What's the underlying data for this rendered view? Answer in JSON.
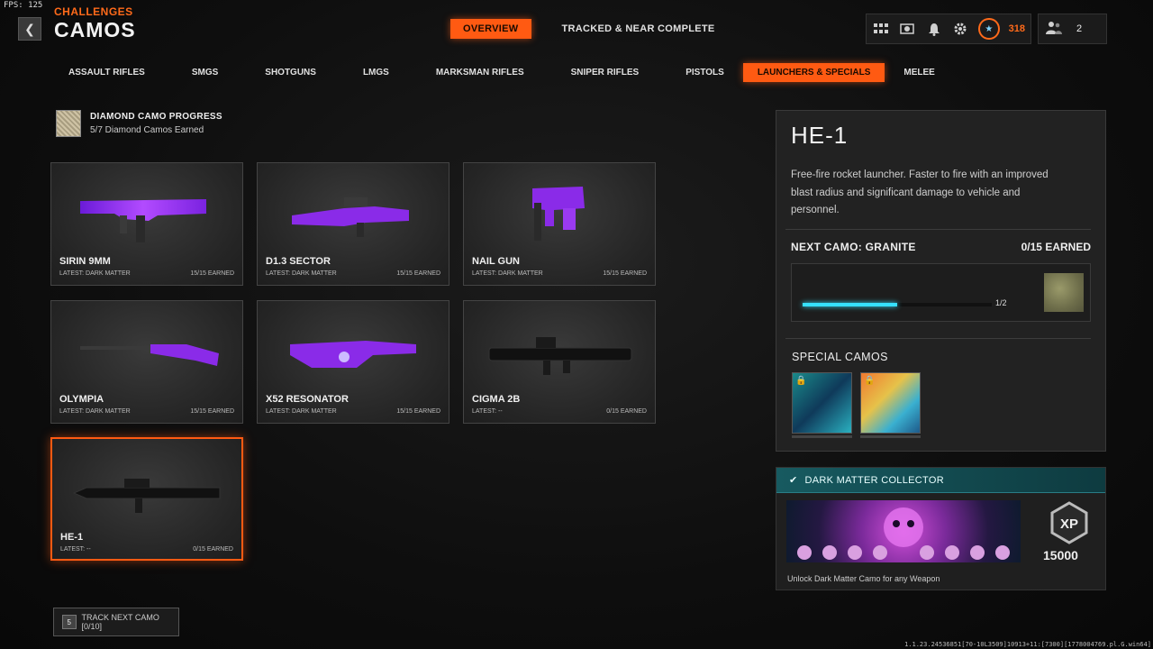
{
  "fps": "FPS: 125",
  "header": {
    "breadcrumb": "CHALLENGES",
    "title": "CAMOS",
    "tabs": [
      {
        "label": "OVERVIEW",
        "active": true
      },
      {
        "label": "TRACKED & NEAR COMPLETE",
        "active": false
      }
    ],
    "rank_value": "318",
    "party_count": "2"
  },
  "categories": [
    {
      "label": "ASSAULT RIFLES"
    },
    {
      "label": "SMGS"
    },
    {
      "label": "SHOTGUNS"
    },
    {
      "label": "LMGS"
    },
    {
      "label": "MARKSMAN RIFLES"
    },
    {
      "label": "SNIPER RIFLES"
    },
    {
      "label": "PISTOLS"
    },
    {
      "label": "LAUNCHERS & SPECIALS",
      "active": true
    },
    {
      "label": "MELEE"
    }
  ],
  "diamond": {
    "title": "DIAMOND CAMO PROGRESS",
    "subtitle": "5/7 Diamond Camos Earned"
  },
  "weapons": [
    {
      "name": "SIRIN 9MM",
      "latest": "LATEST: DARK MATTER",
      "earned": "15/15 EARNED",
      "camo": "dark-matter"
    },
    {
      "name": "D1.3 SECTOR",
      "latest": "LATEST: DARK MATTER",
      "earned": "15/15 EARNED",
      "camo": "dark-matter"
    },
    {
      "name": "NAIL GUN",
      "latest": "LATEST: DARK MATTER",
      "earned": "15/15 EARNED",
      "camo": "dark-matter"
    },
    {
      "name": "OLYMPIA",
      "latest": "LATEST: DARK MATTER",
      "earned": "15/15 EARNED",
      "camo": "dark-matter"
    },
    {
      "name": "X52 RESONATOR",
      "latest": "LATEST: DARK MATTER",
      "earned": "15/15 EARNED",
      "camo": "dark-matter"
    },
    {
      "name": "CIGMA 2B",
      "latest": "LATEST: --",
      "earned": "0/15 EARNED",
      "camo": "none"
    },
    {
      "name": "HE-1",
      "latest": "LATEST: --",
      "earned": "0/15 EARNED",
      "camo": "none",
      "selected": true
    }
  ],
  "detail": {
    "title": "HE-1",
    "description": "Free-fire rocket launcher.  Faster to fire with an improved blast radius and significant damage to vehicle and personnel.",
    "next_camo_label": "NEXT CAMO: GRANITE",
    "next_camo_earned": "0/15 EARNED",
    "progress_text": "1/2",
    "progress_fraction": 0.5,
    "special_title": "SPECIAL CAMOS"
  },
  "challenge": {
    "title": "DARK MATTER COLLECTOR",
    "xp": "15000",
    "xp_label": "XP",
    "description": "Unlock Dark Matter Camo for any Weapon"
  },
  "track_button": {
    "key": "5",
    "label": "TRACK NEXT CAMO [0/10]"
  },
  "build_string": "1.1.23.24536851[70-10L3509]10913+11:[7300][1778004769.pl.G.win64]"
}
